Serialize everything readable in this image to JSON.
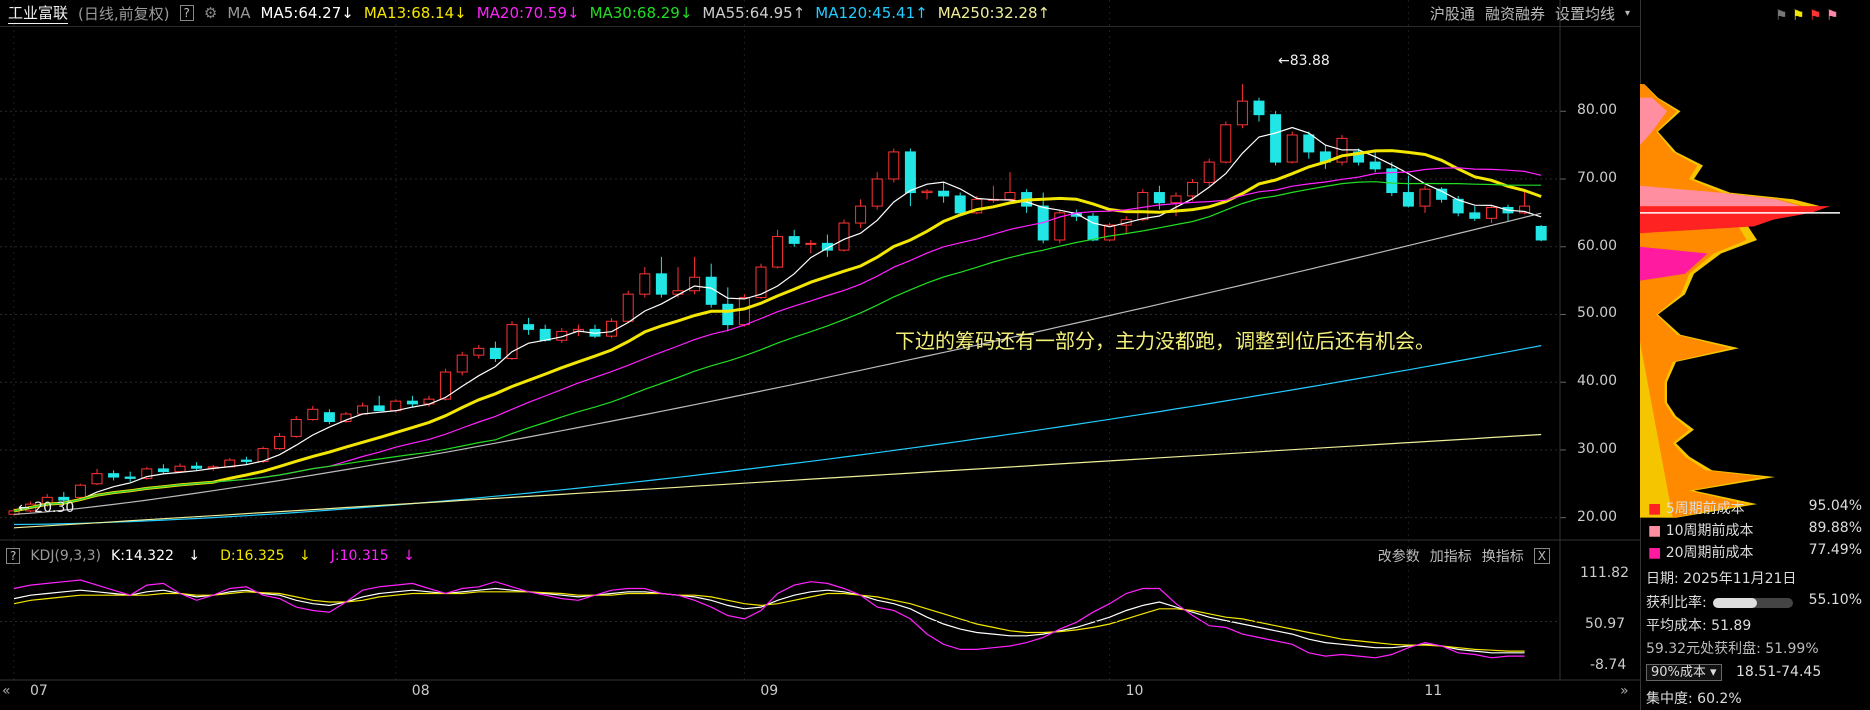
{
  "header": {
    "stock_name": "工业富联",
    "mode": "(日线,前复权)",
    "help": "?",
    "ma_label": "MA",
    "ma_items": [
      {
        "text": "MA5:64.27",
        "arrow": "↓",
        "color": "#ffffff"
      },
      {
        "text": "MA13:68.14",
        "arrow": "↓",
        "color": "#f3e600"
      },
      {
        "text": "MA20:70.59",
        "arrow": "↓",
        "color": "#ff22ff"
      },
      {
        "text": "MA30:68.29",
        "arrow": "↓",
        "color": "#22dd22"
      },
      {
        "text": "MA55:64.95",
        "arrow": "↑",
        "color": "#cccccc"
      },
      {
        "text": "MA120:45.41",
        "arrow": "↑",
        "color": "#22ccff"
      },
      {
        "text": "MA250:32.28",
        "arrow": "↑",
        "color": "#eeee99"
      }
    ],
    "buttons": [
      "沪股通",
      "融资融券",
      "设置均线"
    ]
  },
  "annotation": "下边的筹码还有一部分，主力没都跑，调整到位后还有机会。",
  "kdj": {
    "label": "KDJ(9,3,3)",
    "k": "K:14.322",
    "k_arrow": "↓",
    "d": "D:16.325",
    "d_arrow": "↓",
    "j": "J:10.315",
    "j_arrow": "↓",
    "buttons": [
      "改参数",
      "加指标",
      "换指标"
    ],
    "close": "X",
    "axis": [
      "111.82",
      "50.97",
      "-8.74"
    ]
  },
  "chip_panel": {
    "legend": [
      {
        "label": "5周期前成本",
        "value": "95.04%",
        "color": "#ff2222"
      },
      {
        "label": "10周期前成本",
        "value": "89.88%",
        "color": "#ff8fa0"
      },
      {
        "label": "20周期前成本",
        "value": "77.49%",
        "color": "#ff1aa0"
      }
    ],
    "date": "日期:  2025年11月21日",
    "profit_label": "获利比率:",
    "profit_value": "55.10%",
    "profit_ratio": 0.551,
    "avg_cost": "平均成本:  51.89",
    "profit_at": "59.32元处获利盘:  51.99%",
    "cost_select": "90%成本 ▾",
    "cost_range": "18.51-74.45",
    "concentration": "集中度:  60.2%"
  },
  "colors": {
    "up": "#ff3333",
    "down": "#22e6e6",
    "ma5": "#ffffff",
    "ma13": "#f3e600",
    "ma20": "#ff22ff",
    "ma30": "#22dd22",
    "ma55": "#bbbbbb",
    "ma120": "#22ccff",
    "ma250": "#eeee99"
  },
  "chart_data": {
    "type": "candlestick",
    "price_axis": [
      20,
      30,
      40,
      50,
      60,
      70,
      80
    ],
    "price_labels": [
      "80.00",
      "70.00",
      "60.00",
      "50.00",
      "40.00",
      "30.00",
      "20.00"
    ],
    "ylim": [
      17,
      92
    ],
    "month_labels": [
      {
        "label": "07",
        "index": 0
      },
      {
        "label": "08",
        "index": 23
      },
      {
        "label": "09",
        "index": 44
      },
      {
        "label": "10",
        "index": 66
      },
      {
        "label": "11",
        "index": 84
      }
    ],
    "high_annotation": "←83.88",
    "low_annotation": "← 20.30",
    "candles": [
      [
        20.5,
        21.4,
        20.3,
        21.0
      ],
      [
        21.0,
        22.4,
        20.8,
        22.0
      ],
      [
        22.0,
        23.5,
        21.6,
        23.0
      ],
      [
        23.0,
        23.8,
        22.3,
        22.6
      ],
      [
        23.0,
        25.0,
        22.8,
        24.8
      ],
      [
        25.0,
        27.2,
        24.8,
        26.5
      ],
      [
        26.5,
        27.0,
        25.5,
        26.0
      ],
      [
        26.0,
        26.8,
        25.3,
        25.8
      ],
      [
        25.8,
        27.5,
        25.6,
        27.2
      ],
      [
        27.2,
        27.9,
        26.5,
        26.8
      ],
      [
        26.8,
        28.0,
        26.6,
        27.6
      ],
      [
        27.6,
        28.2,
        27.0,
        27.3
      ],
      [
        27.3,
        27.8,
        26.9,
        27.5
      ],
      [
        27.5,
        28.8,
        27.4,
        28.5
      ],
      [
        28.5,
        29.0,
        27.9,
        28.3
      ],
      [
        28.3,
        30.5,
        28.1,
        30.2
      ],
      [
        30.2,
        32.5,
        30.0,
        32.0
      ],
      [
        32.0,
        35.0,
        31.8,
        34.5
      ],
      [
        34.5,
        36.5,
        34.3,
        36.0
      ],
      [
        35.5,
        36.0,
        33.8,
        34.2
      ],
      [
        34.2,
        35.6,
        34.0,
        35.3
      ],
      [
        35.3,
        37.0,
        35.2,
        36.5
      ],
      [
        36.5,
        38.0,
        36.0,
        35.8
      ],
      [
        35.8,
        37.5,
        35.5,
        37.2
      ],
      [
        37.2,
        38.0,
        36.3,
        36.8
      ],
      [
        36.8,
        38.0,
        36.4,
        37.5
      ],
      [
        37.5,
        42.0,
        37.3,
        41.5
      ],
      [
        41.5,
        44.5,
        41.0,
        44.0
      ],
      [
        44.0,
        45.5,
        43.5,
        45.0
      ],
      [
        45.0,
        46.0,
        43.0,
        43.5
      ],
      [
        43.5,
        49.0,
        43.3,
        48.5
      ],
      [
        48.5,
        49.5,
        47.0,
        47.8
      ],
      [
        47.8,
        48.5,
        46.0,
        46.2
      ],
      [
        46.2,
        48.0,
        45.8,
        47.5
      ],
      [
        47.5,
        48.5,
        46.8,
        47.8
      ],
      [
        47.8,
        48.5,
        46.5,
        46.8
      ],
      [
        46.8,
        49.5,
        46.5,
        49.0
      ],
      [
        49.0,
        53.5,
        48.8,
        53.0
      ],
      [
        53.0,
        57.0,
        52.5,
        56.0
      ],
      [
        56.0,
        58.5,
        52.5,
        53.0
      ],
      [
        53.0,
        57.0,
        52.5,
        53.5
      ],
      [
        53.5,
        58.5,
        53.0,
        55.5
      ],
      [
        55.5,
        57.5,
        51.0,
        51.5
      ],
      [
        51.5,
        54.0,
        47.5,
        48.5
      ],
      [
        48.5,
        53.0,
        48.2,
        52.5
      ],
      [
        52.5,
        57.5,
        52.3,
        57.0
      ],
      [
        57.0,
        62.5,
        56.8,
        61.5
      ],
      [
        61.5,
        62.5,
        60.0,
        60.5
      ],
      [
        60.5,
        61.0,
        59.0,
        60.5
      ],
      [
        60.5,
        61.8,
        58.5,
        59.5
      ],
      [
        59.5,
        64.0,
        59.3,
        63.5
      ],
      [
        63.5,
        67.0,
        62.8,
        66.0
      ],
      [
        66.0,
        71.0,
        65.5,
        70.0
      ],
      [
        70.0,
        74.5,
        69.5,
        74.0
      ],
      [
        74.0,
        74.5,
        66.0,
        68.0
      ],
      [
        68.0,
        68.5,
        67.0,
        68.2
      ],
      [
        68.2,
        69.5,
        66.5,
        67.5
      ],
      [
        67.5,
        68.0,
        64.5,
        65.0
      ],
      [
        65.0,
        67.5,
        64.8,
        67.0
      ],
      [
        67.0,
        69.0,
        66.5,
        67.0
      ],
      [
        67.0,
        71.0,
        66.5,
        68.0
      ],
      [
        68.0,
        68.5,
        65.0,
        66.0
      ],
      [
        66.0,
        68.0,
        60.5,
        61.0
      ],
      [
        61.0,
        65.5,
        60.5,
        65.0
      ],
      [
        65.0,
        65.5,
        63.8,
        64.5
      ],
      [
        64.5,
        65.0,
        60.8,
        61.0
      ],
      [
        61.0,
        63.5,
        60.8,
        63.2
      ],
      [
        63.2,
        64.5,
        62.0,
        64.0
      ],
      [
        64.0,
        68.5,
        63.8,
        68.0
      ],
      [
        68.0,
        69.0,
        65.5,
        66.5
      ],
      [
        66.5,
        68.0,
        64.5,
        67.5
      ],
      [
        67.5,
        70.0,
        66.8,
        69.5
      ],
      [
        69.5,
        73.0,
        69.0,
        72.5
      ],
      [
        72.5,
        78.5,
        72.3,
        78.0
      ],
      [
        78.0,
        84.0,
        77.5,
        81.5
      ],
      [
        81.5,
        82.0,
        78.5,
        79.5
      ],
      [
        79.5,
        80.0,
        72.0,
        72.5
      ],
      [
        72.5,
        77.0,
        72.3,
        76.5
      ],
      [
        76.5,
        77.0,
        73.0,
        74.0
      ],
      [
        74.0,
        75.0,
        71.5,
        72.5
      ],
      [
        72.5,
        76.5,
        72.0,
        76.0
      ],
      [
        74.0,
        74.5,
        72.0,
        72.5
      ],
      [
        72.5,
        74.0,
        71.0,
        71.5
      ],
      [
        71.5,
        72.5,
        67.5,
        68.0
      ],
      [
        68.0,
        70.5,
        65.8,
        66.0
      ],
      [
        66.0,
        69.0,
        65.0,
        68.5
      ],
      [
        68.5,
        68.8,
        66.5,
        67.0
      ],
      [
        67.0,
        67.5,
        64.5,
        65.0
      ],
      [
        65.0,
        66.0,
        63.8,
        64.2
      ],
      [
        64.2,
        66.2,
        63.5,
        65.8
      ],
      [
        65.8,
        66.2,
        63.8,
        65.0
      ],
      [
        65.0,
        68.5,
        64.8,
        66.0
      ],
      [
        63.0,
        63.2,
        60.8,
        61.0
      ]
    ],
    "ma_series": [
      {
        "name": "MA5",
        "color": "#ffffff",
        "last": 64.27
      },
      {
        "name": "MA13",
        "color": "#f3e600",
        "last": 68.14
      },
      {
        "name": "MA20",
        "color": "#ff22ff",
        "last": 70.59
      },
      {
        "name": "MA30",
        "color": "#22dd22",
        "last": 68.29
      },
      {
        "name": "MA55",
        "color": "#bbbbbb",
        "last": 64.95
      },
      {
        "name": "MA120",
        "color": "#22ccff",
        "last": 45.41
      },
      {
        "name": "MA250",
        "color": "#eeee99",
        "last": 32.28
      }
    ],
    "kdj_ylim": [
      -8.74,
      111.82
    ],
    "kdj_k": [
      78,
      82,
      84,
      86,
      88,
      86,
      84,
      82,
      86,
      88,
      84,
      80,
      82,
      86,
      88,
      84,
      82,
      76,
      72,
      70,
      74,
      80,
      84,
      86,
      88,
      86,
      84,
      86,
      88,
      90,
      88,
      86,
      84,
      82,
      80,
      82,
      84,
      86,
      86,
      84,
      82,
      80,
      76,
      70,
      66,
      68,
      76,
      82,
      86,
      88,
      86,
      82,
      76,
      72,
      66,
      56,
      48,
      42,
      38,
      36,
      34,
      34,
      36,
      40,
      44,
      50,
      56,
      64,
      70,
      74,
      68,
      62,
      56,
      52,
      48,
      44,
      40,
      36,
      30,
      26,
      24,
      22,
      20,
      20,
      22,
      24,
      22,
      18,
      16,
      14,
      14,
      14
    ],
    "kdj_d": [
      72,
      76,
      78,
      80,
      82,
      82,
      82,
      82,
      82,
      84,
      84,
      82,
      82,
      84,
      86,
      85,
      84,
      80,
      76,
      74,
      74,
      76,
      80,
      82,
      84,
      84,
      84,
      84,
      86,
      86,
      86,
      86,
      85,
      84,
      82,
      82,
      82,
      84,
      84,
      84,
      82,
      82,
      80,
      76,
      72,
      70,
      72,
      76,
      80,
      84,
      84,
      82,
      80,
      76,
      72,
      66,
      60,
      54,
      48,
      44,
      40,
      38,
      38,
      39,
      41,
      44,
      48,
      54,
      60,
      66,
      66,
      64,
      60,
      56,
      54,
      50,
      46,
      42,
      38,
      34,
      30,
      28,
      26,
      24,
      23,
      23,
      22,
      20,
      18,
      17,
      16,
      16
    ],
    "kdj_j": [
      90,
      94,
      96,
      98,
      100,
      94,
      88,
      82,
      94,
      96,
      84,
      76,
      82,
      90,
      92,
      82,
      78,
      68,
      64,
      62,
      74,
      88,
      92,
      94,
      96,
      90,
      84,
      90,
      92,
      98,
      92,
      86,
      82,
      78,
      76,
      82,
      88,
      90,
      90,
      84,
      82,
      76,
      68,
      58,
      54,
      64,
      84,
      94,
      98,
      96,
      90,
      82,
      68,
      64,
      54,
      36,
      24,
      18,
      18,
      20,
      22,
      26,
      32,
      42,
      50,
      62,
      72,
      84,
      90,
      90,
      72,
      58,
      46,
      44,
      36,
      32,
      28,
      24,
      14,
      10,
      12,
      10,
      8,
      12,
      20,
      26,
      22,
      14,
      12,
      8,
      10,
      10
    ]
  }
}
